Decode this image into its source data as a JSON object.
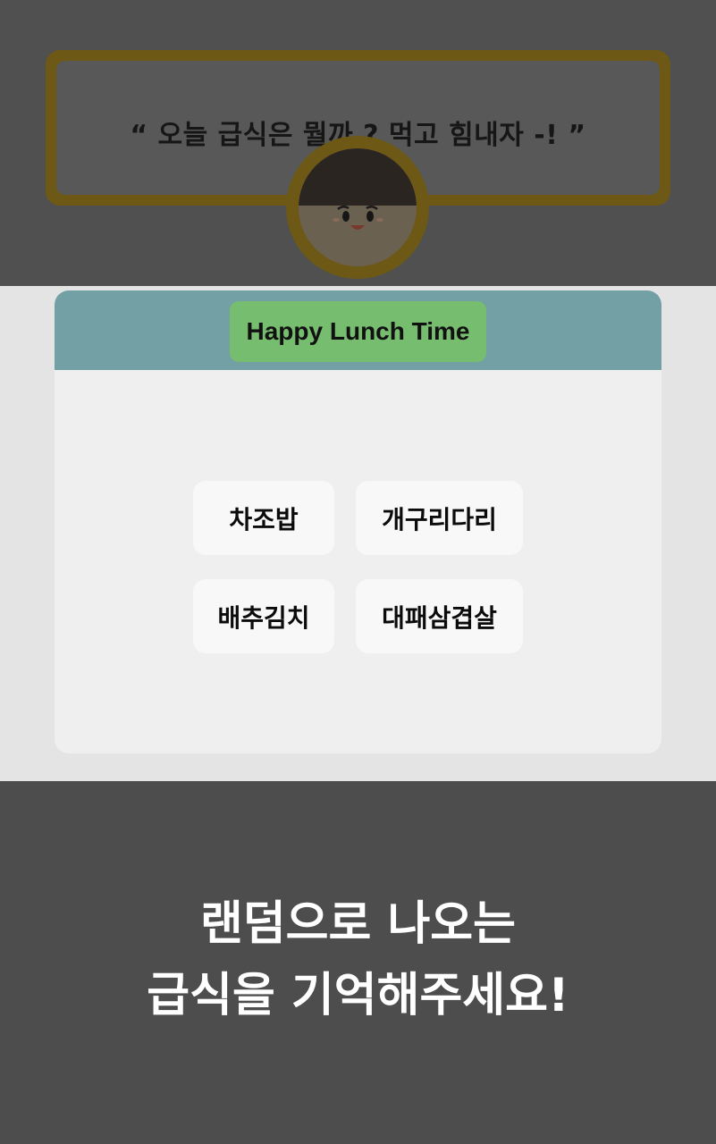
{
  "speech": {
    "text": "“ 오늘 급식은 뭘까 ? 먹고 힘내자 -! ”"
  },
  "card": {
    "title": "Happy Lunch Time"
  },
  "menu": [
    {
      "label": "차조밥"
    },
    {
      "label": "개구리다리"
    },
    {
      "label": "배추김치"
    },
    {
      "label": "대패삼겹살"
    }
  ],
  "instruction": {
    "line1": "랜덤으로 나오는",
    "line2": "급식을 기억해주세요!"
  },
  "colors": {
    "overlay": "#4d4d4d",
    "header": "#73a0a5",
    "title_pill": "#77bd6f",
    "speech_border": "#6d5816"
  },
  "icons": {
    "mascot": "smiling-face-icon"
  }
}
